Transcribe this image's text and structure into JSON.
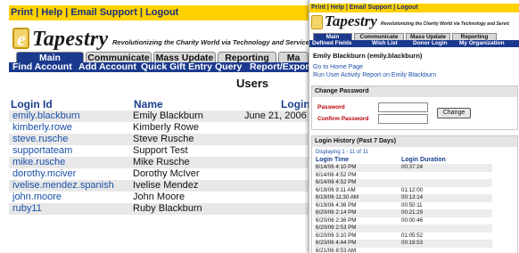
{
  "top_links": {
    "print": "Print",
    "help": "Help",
    "email": "Email Support",
    "logout": "Logout",
    "sep": " | "
  },
  "brand": {
    "letter": "e",
    "name": "Tapestry",
    "tagline": "Revolutionizing the Charity World via Technology and Service"
  },
  "tabs": [
    {
      "label": "Main",
      "active": true
    },
    {
      "label": "Communicate",
      "active": false
    },
    {
      "label": "Mass Update",
      "active": false
    },
    {
      "label": "Reporting",
      "active": false
    },
    {
      "label": "Ma",
      "active": false
    }
  ],
  "subnav": [
    "Find Account",
    "Add Account",
    "Quick Gift Entry",
    "Query",
    "Report/Export"
  ],
  "users": {
    "title": "Users",
    "columns": [
      "Login Id",
      "Name",
      "Login"
    ],
    "rows": [
      {
        "login": "emily.blackburn",
        "name": "Emily Blackburn",
        "last": "June 21, 2006 8"
      },
      {
        "login": "kimberly.rowe",
        "name": "Kimberly Rowe",
        "last": ""
      },
      {
        "login": "steve.rusche",
        "name": "Steve Rusche",
        "last": ""
      },
      {
        "login": "supportateam",
        "name": "Support Test",
        "last": ""
      },
      {
        "login": "mike.rusche",
        "name": "Mike Rusche",
        "last": ""
      },
      {
        "login": "dorothy.mciver",
        "name": "Dorothy McIver",
        "last": ""
      },
      {
        "login": "ivelise.mendez.spanish",
        "name": "Ivelise Mendez",
        "last": ""
      },
      {
        "login": "john.moore",
        "name": "John Moore",
        "last": ""
      },
      {
        "login": "ruby11",
        "name": "Ruby Blackburn",
        "last": ""
      }
    ]
  },
  "detail": {
    "top_links": "Print | Help | Email Support | Logout",
    "tagline": "Revolutionizing the Charity World via Technology and Servic",
    "tabs": [
      "Main",
      "Communicate",
      "Mass Update",
      "Reporting"
    ],
    "subnav": [
      "Defined Fields",
      "Wish List",
      "Donor Login",
      "My Organization"
    ],
    "user_heading": "Emily Blackburn (emily.blackburn)",
    "link_home": "Go to Home Page",
    "link_report": "Run User Activity Report on Emily Blackburn",
    "change_password": {
      "title": "Change Password",
      "password_label": "Password",
      "confirm_label": "Confirm Password",
      "button": "Change"
    },
    "login_history": {
      "title": "Login History (Past 7 Days)",
      "displaying": "Displaying 1 - 11 of 11",
      "col_time": "Login Time",
      "col_duration": "Login Duration",
      "rows": [
        {
          "time": "6/14/06 4:10 PM",
          "dur": "00:37:24"
        },
        {
          "time": "6/14/06 4:52 PM",
          "dur": ""
        },
        {
          "time": "6/14/06 4:52 PM",
          "dur": ""
        },
        {
          "time": "6/19/06 9:11 AM",
          "dur": "01:12:00"
        },
        {
          "time": "6/19/06 11:30 AM",
          "dur": "00:13:14"
        },
        {
          "time": "6/19/06 4:36 PM",
          "dur": "00:50:11"
        },
        {
          "time": "6/20/06 2:14 PM",
          "dur": "00:21:29"
        },
        {
          "time": "6/20/06 2:36 PM",
          "dur": "00:00:46"
        },
        {
          "time": "6/20/06 2:53 PM",
          "dur": ""
        },
        {
          "time": "6/20/06 3:10 PM",
          "dur": "01:05:52"
        },
        {
          "time": "6/20/06 4:44 PM",
          "dur": "00:19:53"
        },
        {
          "time": "6/21/06 8:53 AM",
          "dur": ""
        }
      ]
    }
  },
  "colors": {
    "nav_blue": "#1b3a8e",
    "top_yellow": "#ffd200",
    "link_blue": "#1a4fa8",
    "label_red": "#b80000"
  }
}
